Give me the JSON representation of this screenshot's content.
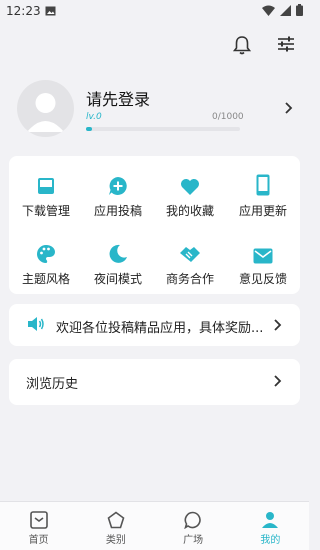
{
  "status": {
    "time": "12:23"
  },
  "profile": {
    "login_text": "请先登录",
    "level": "lv.0",
    "exp": "0/1000",
    "progress_fraction": 0.04
  },
  "grid": {
    "items": [
      {
        "label": "下载管理",
        "icon": "download-tray-icon"
      },
      {
        "label": "应用投稿",
        "icon": "chat-plus-icon"
      },
      {
        "label": "我的收藏",
        "icon": "heart-icon"
      },
      {
        "label": "应用更新",
        "icon": "phone-icon"
      },
      {
        "label": "主题风格",
        "icon": "palette-icon"
      },
      {
        "label": "夜间模式",
        "icon": "moon-icon"
      },
      {
        "label": "商务合作",
        "icon": "handshake-icon"
      },
      {
        "label": "意见反馈",
        "icon": "mail-icon"
      }
    ]
  },
  "notice": {
    "text": "欢迎各位投稿精品应用，具体奖励..."
  },
  "history": {
    "label": "浏览历史"
  },
  "nav": {
    "items": [
      {
        "label": "首页"
      },
      {
        "label": "类别"
      },
      {
        "label": "广场"
      },
      {
        "label": "我的"
      }
    ]
  },
  "colors": {
    "accent": "#29b6c9",
    "background": "#f2f2f5"
  }
}
